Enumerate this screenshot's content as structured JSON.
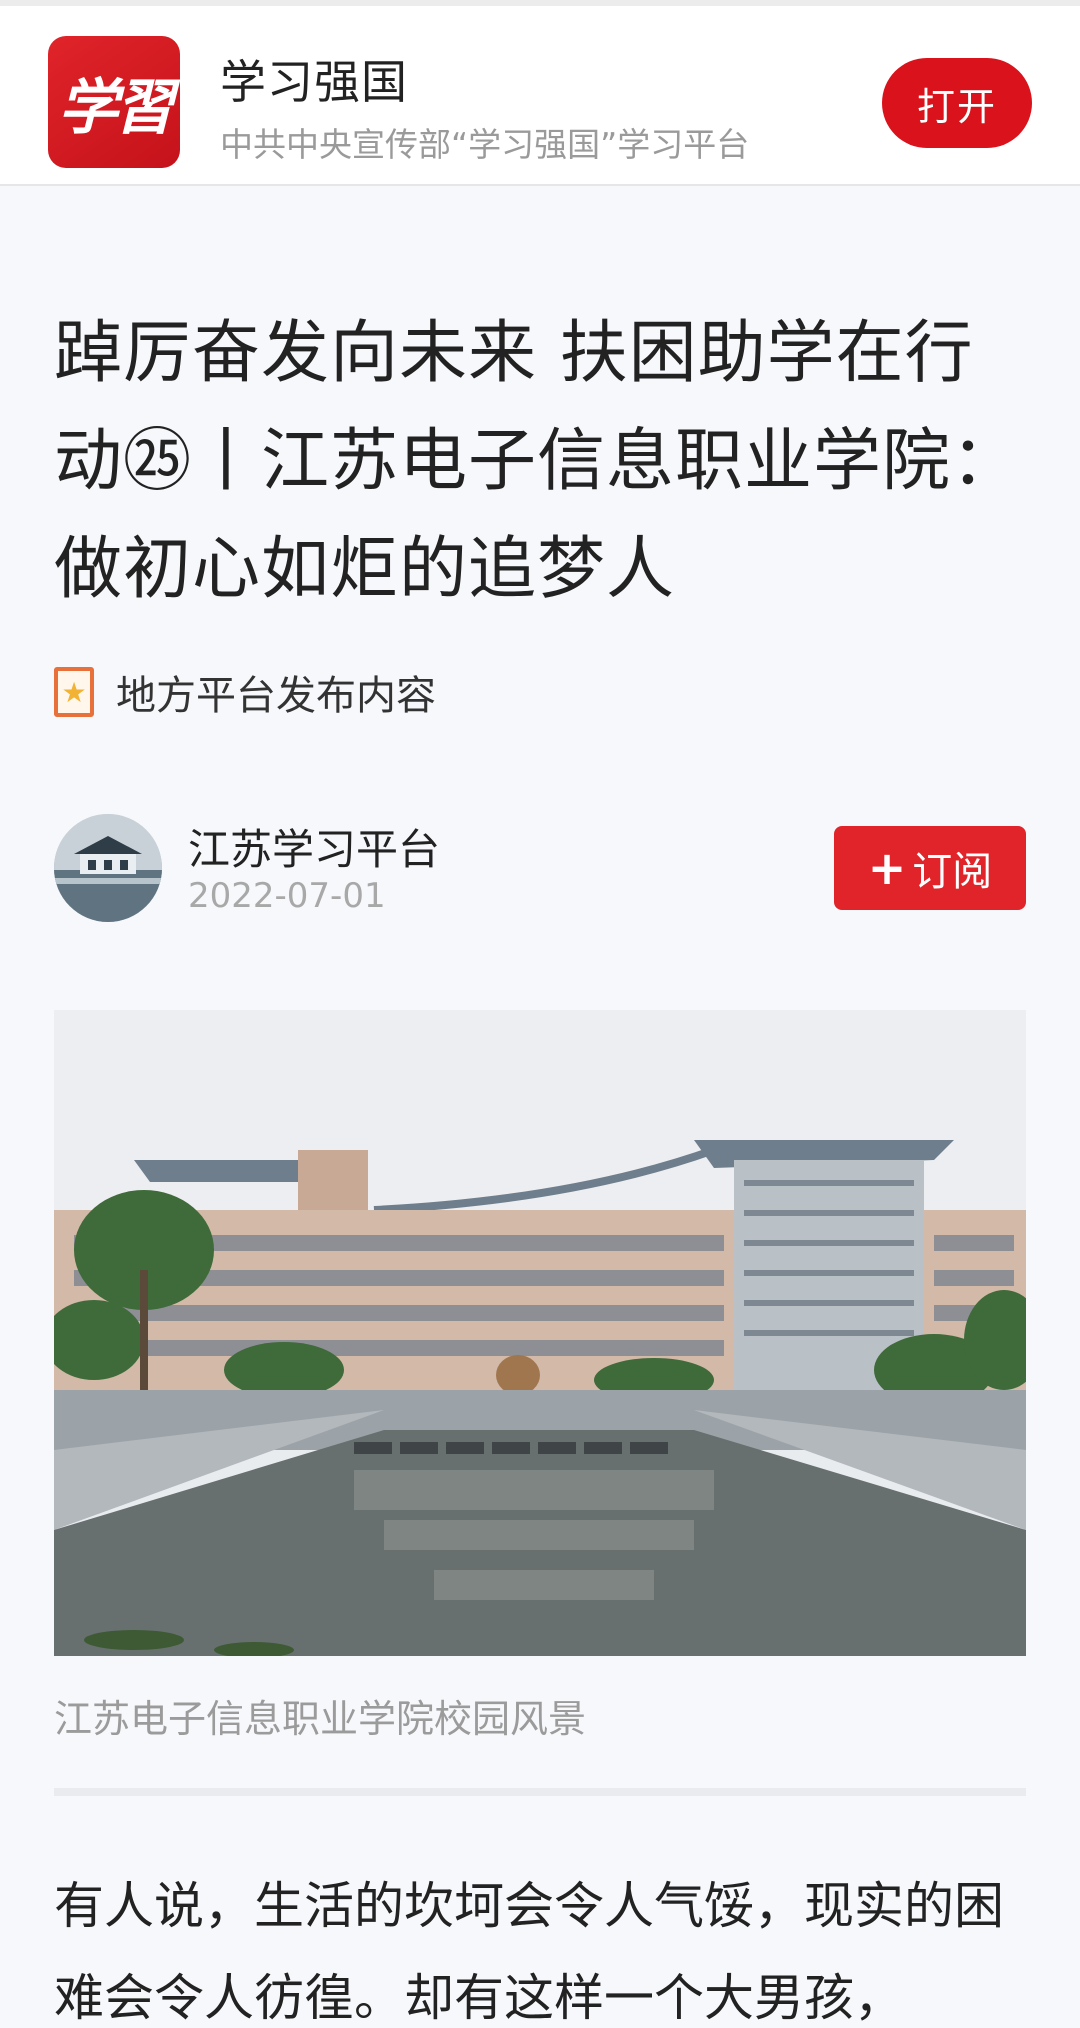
{
  "banner": {
    "logo_text": "学習",
    "app_name": "学习强国",
    "app_desc": "中共中央宣传部“学习强国”学习平台",
    "open_label": "打开"
  },
  "article": {
    "title": "踔厉奋发向未来 扶困助学在行动㉕丨江苏电子信息职业学院：做初心如炬的追梦人",
    "source_tag": "地方平台发布内容",
    "author": {
      "name": "江苏学习平台",
      "date": "2022-07-01",
      "subscribe_label": "订阅"
    },
    "photo_caption": "江苏电子信息职业学院校园风景",
    "body": "有人说，生活的坎坷会令人气馁，现实的困难会令人彷徨。却有这样一个大男孩，"
  },
  "icons": {
    "tag": "bookmark-star-icon",
    "subscribe": "plus-icon"
  },
  "colors": {
    "brand_red": "#d9121b",
    "subscribe_red": "#e0242a",
    "tag_orange": "#e8703a"
  }
}
